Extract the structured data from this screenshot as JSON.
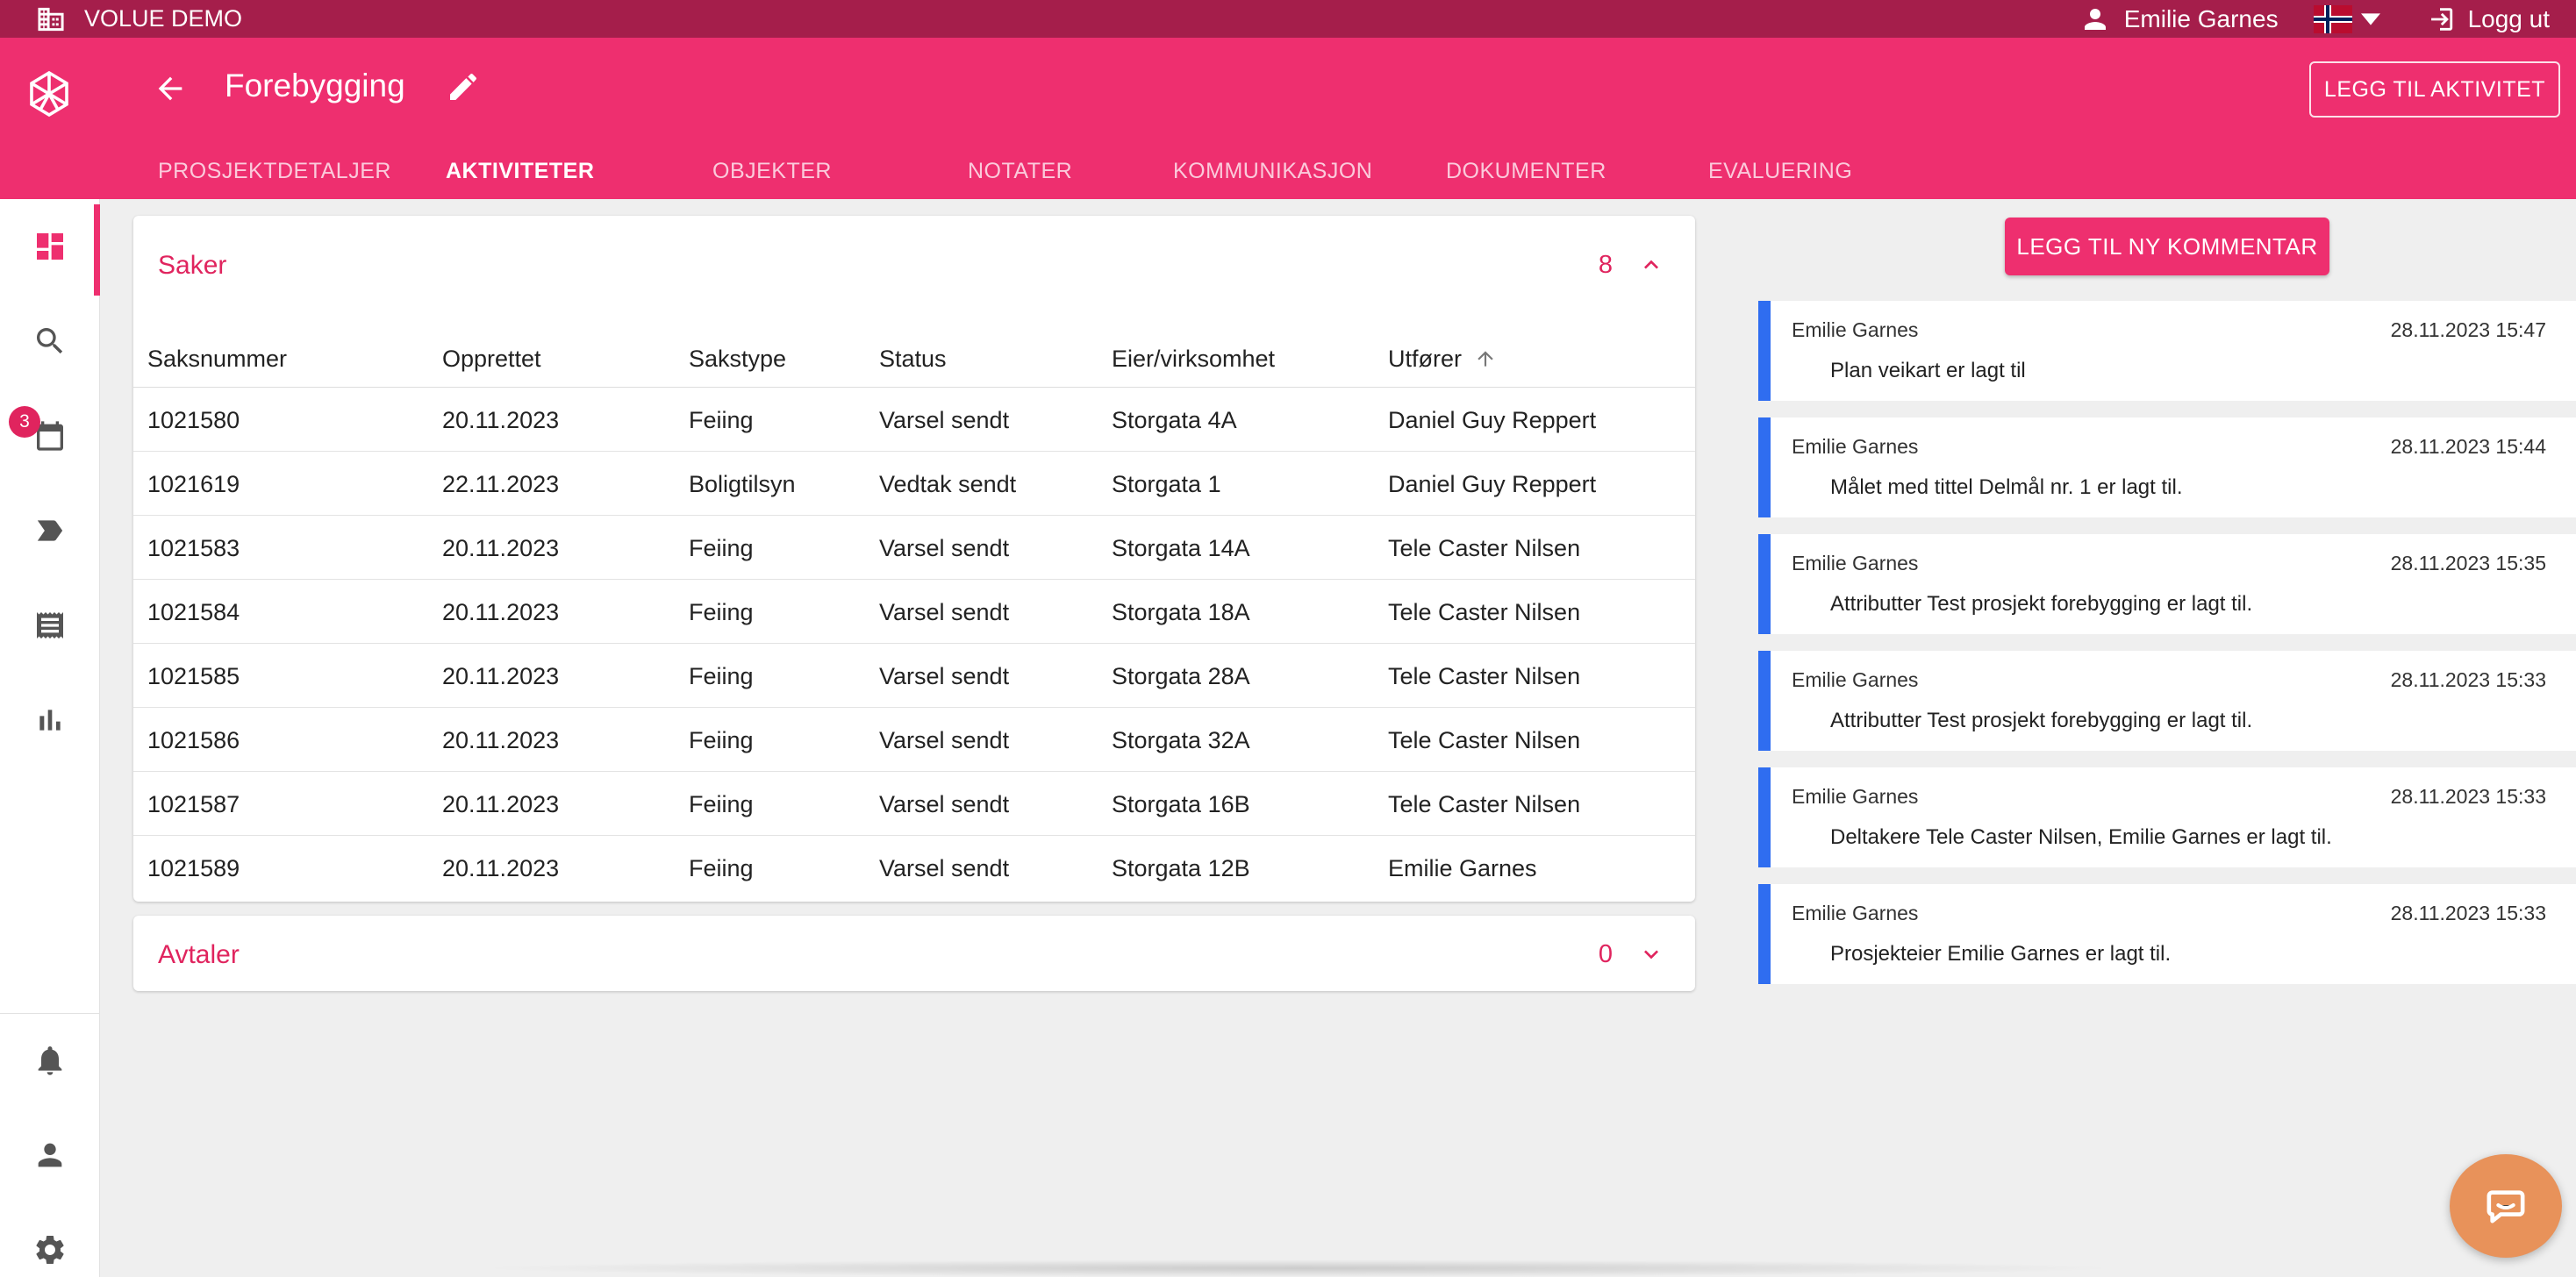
{
  "topbar": {
    "org": "VOLUE DEMO",
    "user": "Emilie Garnes",
    "logout": "Logg ut"
  },
  "header": {
    "title": "Forebygging",
    "add_activity": "LEGG TIL AKTIVITET"
  },
  "tabs": [
    {
      "label": "PROSJEKTDETALJER",
      "active": false
    },
    {
      "label": "AKTIVITETER",
      "active": true
    },
    {
      "label": "OBJEKTER",
      "active": false
    },
    {
      "label": "NOTATER",
      "active": false
    },
    {
      "label": "KOMMUNIKASJON",
      "active": false
    },
    {
      "label": "DOKUMENTER",
      "active": false
    },
    {
      "label": "EVALUERING",
      "active": false
    }
  ],
  "sidebar": {
    "calendar_badge": "3"
  },
  "saker": {
    "title": "Saker",
    "count": "8",
    "columns": [
      "Saksnummer",
      "Opprettet",
      "Sakstype",
      "Status",
      "Eier/virksomhet",
      "Utfører"
    ],
    "rows": [
      [
        "1021580",
        "20.11.2023",
        "Feiing",
        "Varsel sendt",
        "Storgata 4A",
        "Daniel Guy Reppert"
      ],
      [
        "1021619",
        "22.11.2023",
        "Boligtilsyn",
        "Vedtak sendt",
        "Storgata 1",
        "Daniel Guy Reppert"
      ],
      [
        "1021583",
        "20.11.2023",
        "Feiing",
        "Varsel sendt",
        "Storgata 14A",
        "Tele Caster Nilsen"
      ],
      [
        "1021584",
        "20.11.2023",
        "Feiing",
        "Varsel sendt",
        "Storgata 18A",
        "Tele Caster Nilsen"
      ],
      [
        "1021585",
        "20.11.2023",
        "Feiing",
        "Varsel sendt",
        "Storgata 28A",
        "Tele Caster Nilsen"
      ],
      [
        "1021586",
        "20.11.2023",
        "Feiing",
        "Varsel sendt",
        "Storgata 32A",
        "Tele Caster Nilsen"
      ],
      [
        "1021587",
        "20.11.2023",
        "Feiing",
        "Varsel sendt",
        "Storgata 16B",
        "Tele Caster Nilsen"
      ],
      [
        "1021589",
        "20.11.2023",
        "Feiing",
        "Varsel sendt",
        "Storgata 12B",
        "Emilie Garnes"
      ]
    ]
  },
  "avtaler": {
    "title": "Avtaler",
    "count": "0"
  },
  "comments": {
    "add_label": "LEGG TIL NY KOMMENTAR",
    "items": [
      {
        "author": "Emilie Garnes",
        "time": "28.11.2023 15:47",
        "text": "Plan veikart er lagt til"
      },
      {
        "author": "Emilie Garnes",
        "time": "28.11.2023 15:44",
        "text": "Målet med tittel Delmål nr. 1 er lagt til."
      },
      {
        "author": "Emilie Garnes",
        "time": "28.11.2023 15:35",
        "text": "Attributter Test prosjekt forebygging er lagt til."
      },
      {
        "author": "Emilie Garnes",
        "time": "28.11.2023 15:33",
        "text": "Attributter Test prosjekt forebygging er lagt til."
      },
      {
        "author": "Emilie Garnes",
        "time": "28.11.2023 15:33",
        "text": "Deltakere Tele Caster Nilsen, Emilie Garnes er lagt til."
      },
      {
        "author": "Emilie Garnes",
        "time": "28.11.2023 15:33",
        "text": "Prosjekteier Emilie Garnes er lagt til."
      }
    ]
  },
  "colors": {
    "brand": "#ee2f6f",
    "topbar": "#a51e4b",
    "accent_blue": "#2f6df0",
    "chat": "#e8925a"
  }
}
